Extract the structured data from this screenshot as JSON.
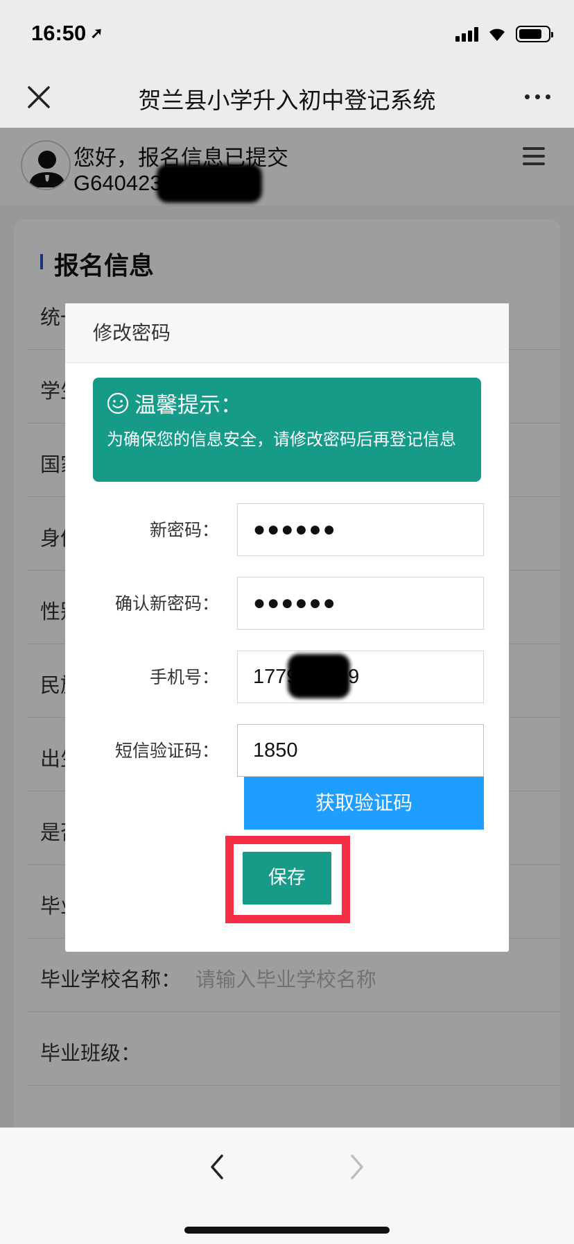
{
  "status_bar": {
    "time": "16:50"
  },
  "nav": {
    "title": "贺兰县小学升入初中登记系统"
  },
  "user": {
    "greeting": "您好，报名信息已提交",
    "reg_number": "G640423201 0030"
  },
  "form": {
    "section_title": "报名信息",
    "rows": [
      {
        "label": "统一",
        "placeholder": ""
      },
      {
        "label": "学生",
        "placeholder": ""
      },
      {
        "label": "国家",
        "placeholder": ""
      },
      {
        "label": "身份",
        "placeholder": ""
      },
      {
        "label": "性别",
        "placeholder": ""
      },
      {
        "label": "民族",
        "placeholder": ""
      },
      {
        "label": "出生",
        "placeholder": ""
      },
      {
        "label": "是否",
        "placeholder": ""
      },
      {
        "label": "毕业",
        "placeholder": ""
      },
      {
        "label": "毕业学校名称：",
        "placeholder": "请输入毕业学校名称"
      },
      {
        "label": "毕业班级：",
        "placeholder": ""
      }
    ]
  },
  "modal": {
    "title": "修改密码",
    "tip_title": "温馨提示：",
    "tip_body": "为确保您的信息安全，请修改密码后再登记信息",
    "fields": {
      "new_password_label": "新密码：",
      "new_password_value": "●●●●●●",
      "confirm_password_label": "确认新密码：",
      "confirm_password_value": "●●●●●●",
      "phone_label": "手机号：",
      "phone_value": "17795 5129",
      "sms_code_label": "短信验证码：",
      "sms_code_value": "1850"
    },
    "get_code_button": "获取验证码",
    "save_button": "保存"
  },
  "colors": {
    "teal": "#179b89",
    "blue_button": "#1e9eff",
    "highlight_red": "#f52d46",
    "section_accent": "#2b55c7"
  }
}
